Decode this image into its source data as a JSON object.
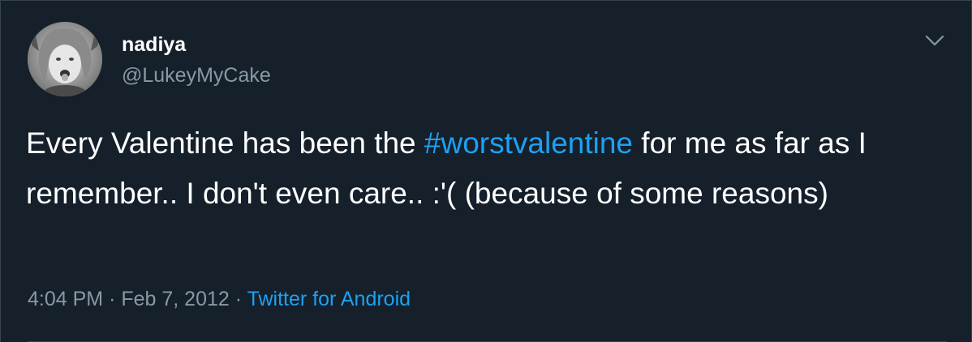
{
  "tweet": {
    "display_name": "nadiya",
    "handle": "@LukeyMyCake",
    "text_before": "Every Valentine has been the ",
    "hashtag": "#worstvalentine",
    "text_after": " for me as far as I remember.. I don't even care.. :'( (because of some reasons)",
    "time": "4:04 PM",
    "separator": "·",
    "date": "Feb 7, 2012",
    "source": "Twitter for Android"
  },
  "colors": {
    "background": "#15202b",
    "primary_text": "#ffffff",
    "secondary_text": "#8899a6",
    "accent": "#1da1f2"
  },
  "icons": {
    "menu": "chevron-down-icon",
    "avatar": "user-avatar"
  }
}
